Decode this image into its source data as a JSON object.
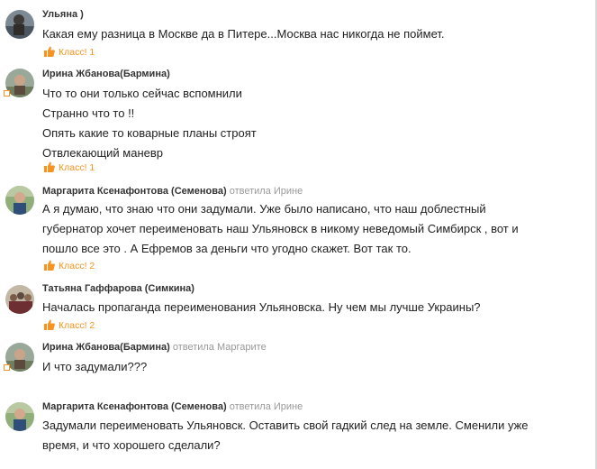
{
  "comments": [
    {
      "author": "Ульяна )",
      "lines": [
        "Какая ему разница в Москве да в Питере...Москва нас никогда не поймет."
      ],
      "like_label": "Класс! 1"
    },
    {
      "author": "Ирина Жбанова(Бармина)",
      "lines": [
        "Что то они только сейчас вспомнили",
        "Странно что то !!",
        "Опять какие то коварные планы строят",
        "Отвлекающий маневр"
      ],
      "like_label": "Класс! 1"
    },
    {
      "author": "Маргарита Ксенафонтова (Семенова)",
      "reply_prefix": "ответила",
      "reply_to": "Ирине",
      "lines": [
        "А я думаю, что знаю что они задумали. Уже было написано, что наш доблестный",
        "губернатор хочет переименовать наш Ульяновск в никому неведомый Симбирск , вот и",
        "пошло все это . А Ефремов за деньги что угодно скажет. Вот так то."
      ],
      "like_label": "Класс! 2"
    },
    {
      "author": "Татьяна Гаффарова (Симкина)",
      "lines": [
        "Началась пропаганда переименования Ульяновска. Ну чем мы лучше Украины?"
      ],
      "like_label": "Класс! 2"
    },
    {
      "author": "Ирина Жбанова(Бармина)",
      "reply_prefix": "ответила",
      "reply_to": "Маргарите",
      "lines": [
        "И что  задумали???"
      ]
    },
    {
      "author": "Маргарита Ксенафонтова (Семенова)",
      "reply_prefix": "ответила",
      "reply_to": "Ирине",
      "lines": [
        "Задумали переименовать Ульяновск. Оставить свой гадкий след на земле. Сменили уже",
        "время, и что хорошего сделали?"
      ]
    }
  ],
  "icons": {
    "like": "thumbs-up-icon"
  },
  "colors": {
    "accent": "#f7931e",
    "reply_text": "#999999",
    "author_text": "#333333"
  }
}
